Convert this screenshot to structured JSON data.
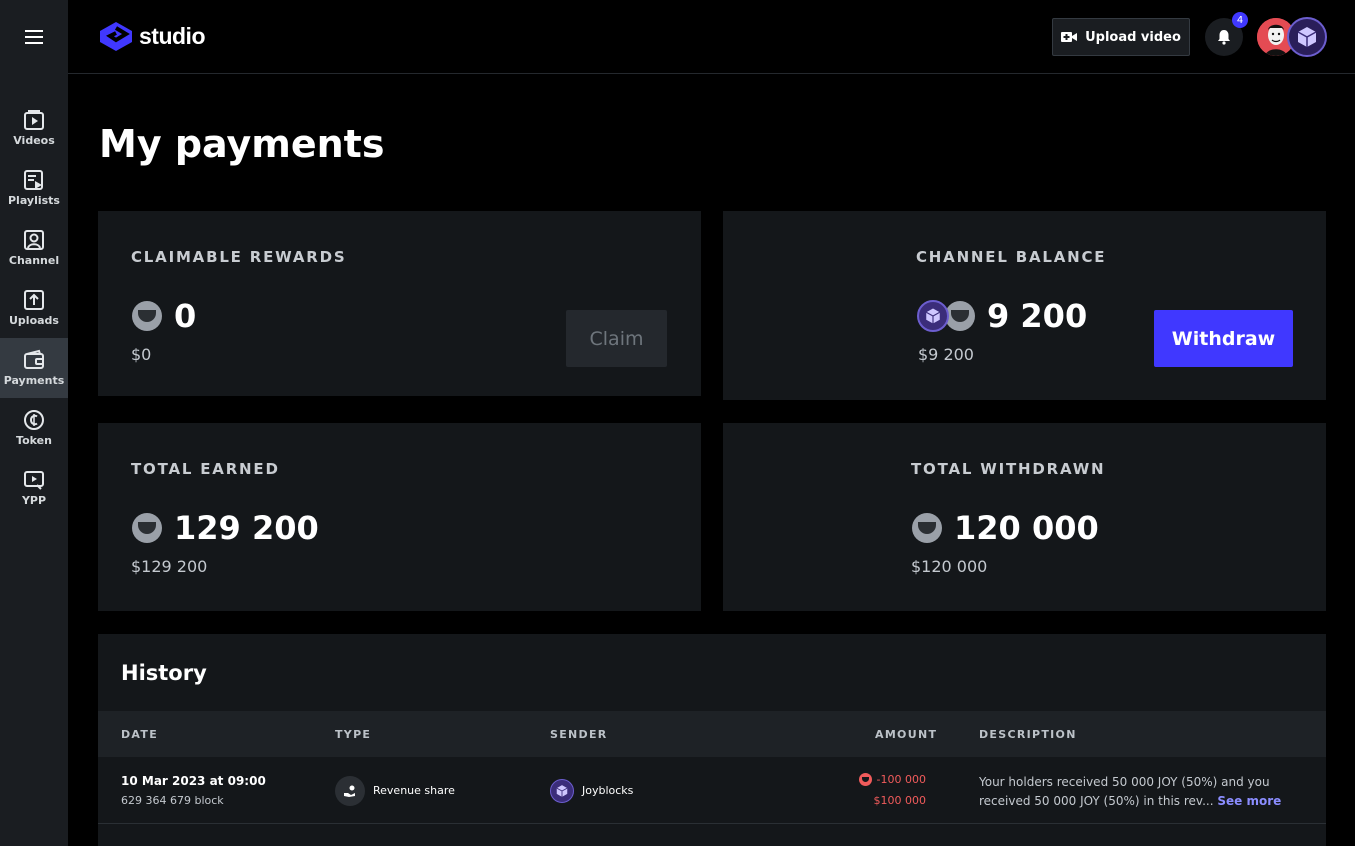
{
  "app": {
    "logo_text": "studio"
  },
  "sidebar": {
    "items": [
      {
        "label": "Videos",
        "icon": "videos-icon"
      },
      {
        "label": "Playlists",
        "icon": "playlists-icon"
      },
      {
        "label": "Channel",
        "icon": "channel-icon"
      },
      {
        "label": "Uploads",
        "icon": "uploads-icon"
      },
      {
        "label": "Payments",
        "icon": "wallet-icon",
        "active": true
      },
      {
        "label": "Token",
        "icon": "token-icon"
      },
      {
        "label": "YPP",
        "icon": "ypp-icon"
      }
    ]
  },
  "topbar": {
    "upload_label": "Upload video",
    "notification_count": "4"
  },
  "page": {
    "title": "My payments"
  },
  "cards": {
    "claimable": {
      "label": "CLAIMABLE REWARDS",
      "amount": "0",
      "usd": "$0",
      "button": "Claim"
    },
    "balance": {
      "label": "CHANNEL BALANCE",
      "amount": "9 200",
      "usd": "$9 200",
      "button": "Withdraw"
    },
    "earned": {
      "label": "TOTAL EARNED",
      "amount": "129 200",
      "usd": "$129 200"
    },
    "withdrawn": {
      "label": "TOTAL WITHDRAWN",
      "amount": "120 000",
      "usd": "$120 000"
    }
  },
  "history": {
    "title": "History",
    "columns": {
      "date": "DATE",
      "type": "TYPE",
      "sender": "SENDER",
      "amount": "AMOUNT",
      "description": "DESCRIPTION"
    },
    "rows": [
      {
        "date": "10 Mar 2023 at 09:00",
        "block": "629 364 679 block",
        "type": "Revenue share",
        "sender": "Joyblocks",
        "amount": "-100 000",
        "amount_usd": "$100 000",
        "description": "Your holders received 50 000 JOY (50%) and you received 50 000 JOY (50%) in this rev...",
        "see_more": "See more"
      }
    ]
  },
  "colors": {
    "accent": "#4038ff",
    "negative": "#f05b5b",
    "link": "#8b8dff"
  }
}
